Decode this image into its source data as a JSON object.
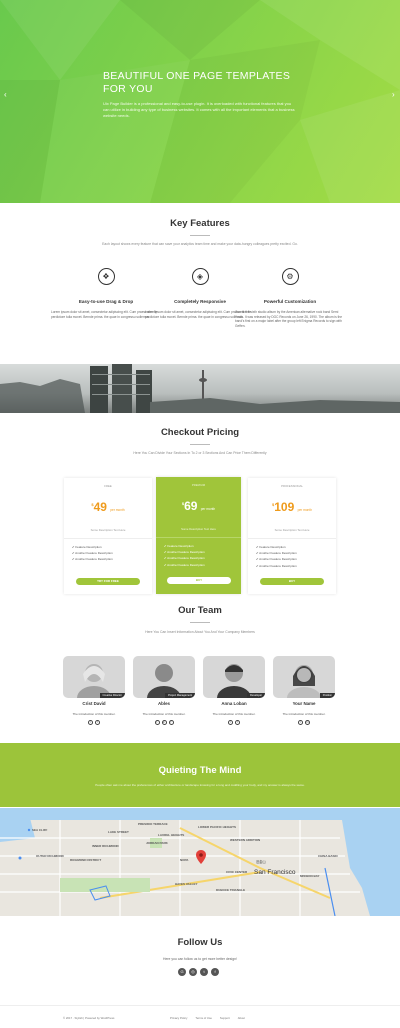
{
  "hero": {
    "title": "BEAUTIFUL ONE PAGE TEMPLATES FOR YOU",
    "text": "Uix Page Builder is a professional and easy-to-use plugin. It is overloaded with functional features that you can utilize in building any type of business websites. It comes with all the important elements that a business website needs.",
    "prev_arrow": "‹",
    "next_arrow": "›"
  },
  "features": {
    "title": "Key Features",
    "subtitle": "Each layout shows every feature that can save your analytics team time and make your data-hungry colleagues pretty excited. Go.",
    "items": [
      {
        "icon": "cubes-icon",
        "glyph": "❖",
        "title": "Easy-to-use Drag & Drop",
        "text": "Lorem ipsum dolor sit amet, consectetur adipiscing elit. Cum praesentim fle perdictore tulla movet. Bernde prima. the quae in congressu sollemus."
      },
      {
        "icon": "diamond-icon",
        "glyph": "◈",
        "title": "Completely Responsive",
        "text": "Lorem ipsum dolor sit amet, consectetur adipiscing elit. Cum praesentim fle perdictore tulla movet. Bernde prima. the quae in congressu sollemus."
      },
      {
        "icon": "gears-icon",
        "glyph": "⚙",
        "title": "Powerful Customization",
        "text": "Gou is the sixth studio album by the American alternative rock band Semi Youth. It was released by DGC Records on June 26, 1990. The album is the band's first on a major label after the group left Enigma Records to sign with Geffen."
      }
    ]
  },
  "pricing": {
    "title": "Checkout Pricing",
    "subtitle": "Here You Can Divide Your Sections In To 2 or 3 Sections And Can Price Them Differently",
    "plans": [
      {
        "name": "FREE",
        "currency": "$",
        "amount": "49",
        "period": "per month",
        "desc": "Some Description Text Here",
        "features": [
          "✔ Feature Description",
          "✔ Another Feature Description",
          "✔ Another Feature Description"
        ],
        "button": "TRY FOR FREE"
      },
      {
        "name": "PREMIUM",
        "currency": "$",
        "amount": "69",
        "period": "per month",
        "desc": "Some Description Text Here",
        "features": [
          "✔ Feature Description",
          "✔ Another Feature Description",
          "✔ Another Feature Description",
          "✔ Another Feature Description"
        ],
        "button": "BUY"
      },
      {
        "name": "PROFESSIONAL",
        "currency": "$",
        "amount": "109",
        "period": "per month",
        "desc": "Some Description Text Here",
        "features": [
          "✔ Feature Description",
          "✔ Another Feature Description",
          "✔ Another Feature Description",
          "✔ Another Feature Description"
        ],
        "button": "BUY"
      }
    ]
  },
  "team": {
    "title": "Our Team",
    "subtitle": "Here You Can Insert Information About You And Your Company Members",
    "members": [
      {
        "name": "Crist David",
        "role": "Creative Director",
        "desc": "The introduction of this member.",
        "social": [
          "t",
          "f"
        ]
      },
      {
        "name": "Ables",
        "role": "Project Management",
        "desc": "The introduction of this member.",
        "social": [
          "t",
          "in",
          "f"
        ]
      },
      {
        "name": "Anna Loban",
        "role": "Developer",
        "desc": "The introduction of this member.",
        "social": [
          "t",
          "f"
        ]
      },
      {
        "name": "Your Name",
        "role": "Position",
        "desc": "The introduction of this member.",
        "social": [
          "t",
          "in"
        ]
      }
    ]
  },
  "quote": {
    "title": "Quieting The Mind",
    "text": "People often ask me about the preferences of either architecture or landscape knowing for a long and cuddling your body, and my answer is always the same."
  },
  "map": {
    "city_label": "San Francisco",
    "city_label_cn": "旧金山",
    "labels": [
      "SEA CLIFF",
      "PRESIDIO TERRACE",
      "LAKE STREET",
      "LAUREL HEIGHTS",
      "JORDAN PARK",
      "LOWER PACIFIC HEIGHTS",
      "WESTERN ADDITION",
      "INNER RICHMOND",
      "RICHMOND DISTRICT",
      "OUTER RICHMOND",
      "NOPA",
      "CIVIC CENTER",
      "HAYES VALLEY",
      "DUBOCE TRIANGLE",
      "MISSION BAY",
      "CHINA BASIN"
    ],
    "marker_icon": "map-pin-icon"
  },
  "follow": {
    "title": "Follow Us",
    "subtitle": "Here you can follow us to get more better design!",
    "icons": [
      "G",
      "◎",
      "t",
      "f"
    ]
  },
  "footer": {
    "copyright": "© 2017 · Stylish | Powered by WordPress",
    "links": [
      "Privacy Policy",
      "Terms of Use",
      "Support",
      "About"
    ]
  }
}
